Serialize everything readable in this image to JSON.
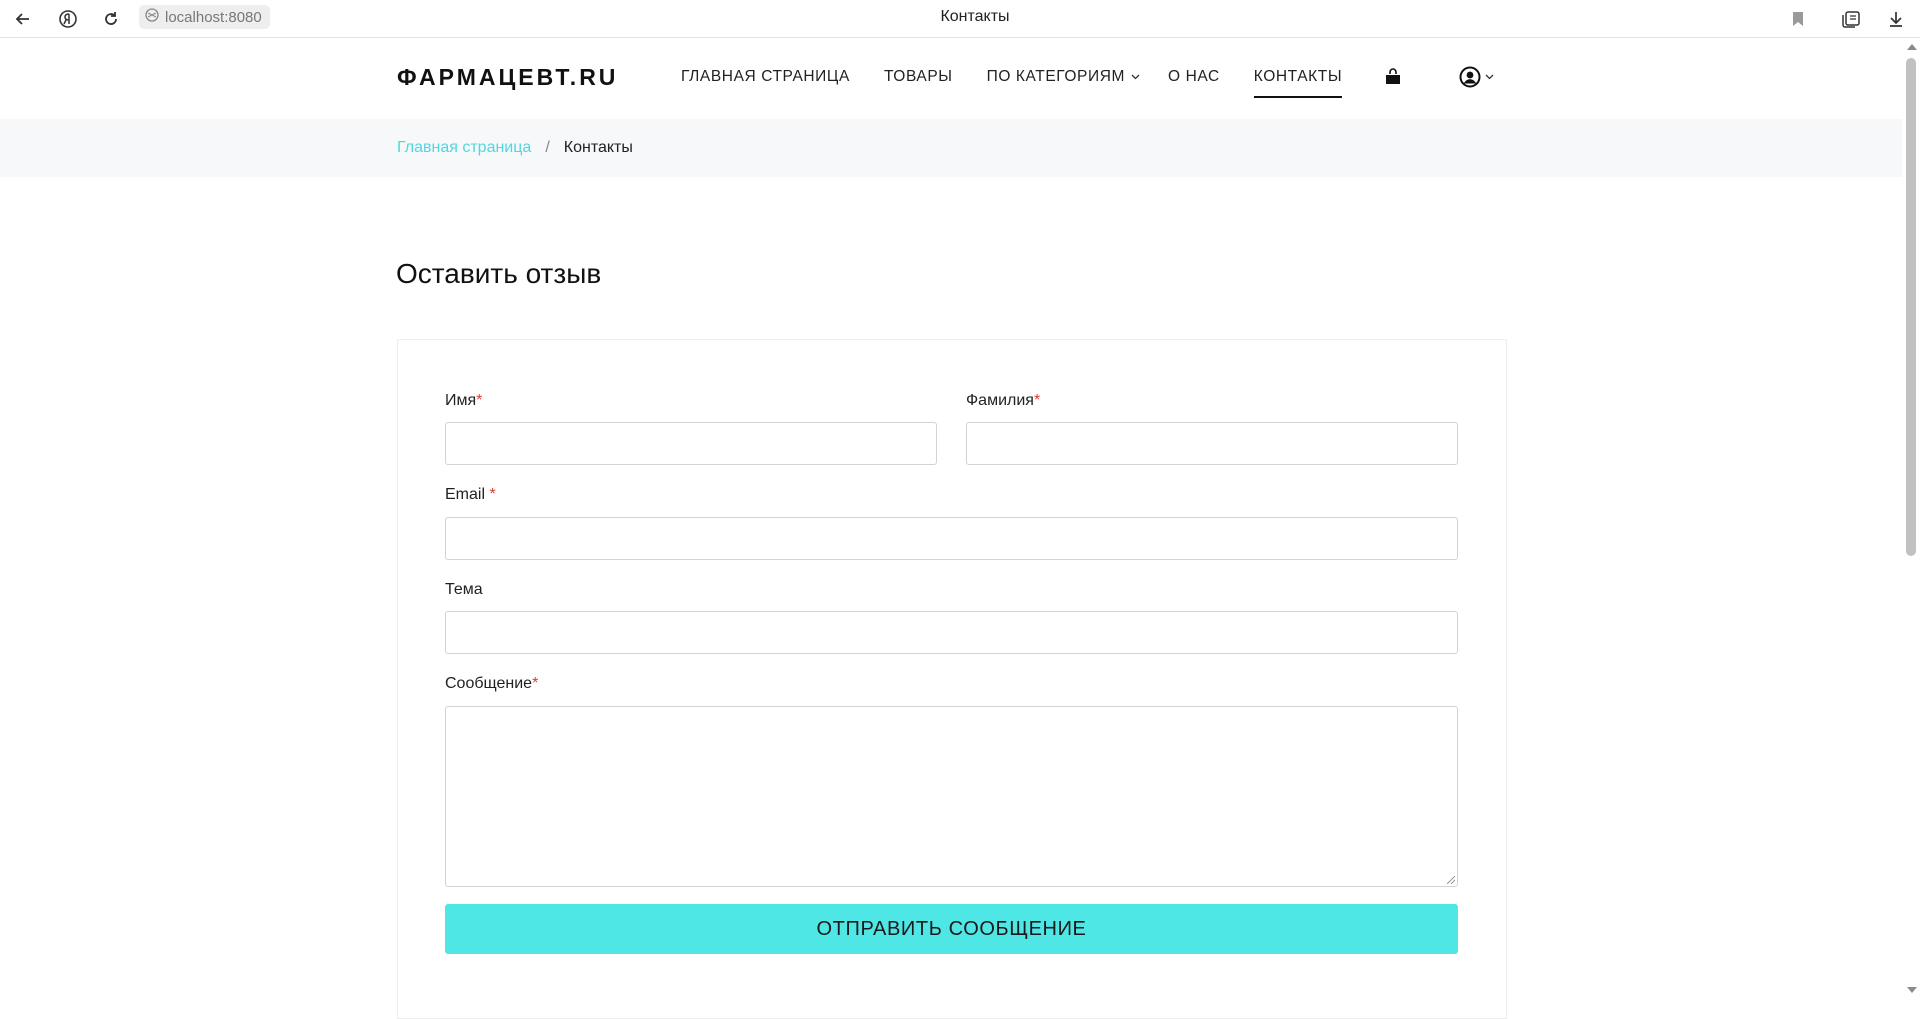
{
  "browser": {
    "address": "localhost:8080",
    "tab_title": "Контакты",
    "icons": {
      "back": "back-arrow-icon",
      "yandex": "yandex-icon",
      "reload": "reload-icon",
      "site_info": "site-info-icon",
      "bookmark": "bookmark-icon",
      "collections": "collections-icon",
      "downloads": "download-icon"
    }
  },
  "header": {
    "logo": "ФАРМАЦЕВТ.RU",
    "nav": [
      {
        "label": "Главная страница"
      },
      {
        "label": "Товары"
      },
      {
        "label": "По категориям"
      },
      {
        "label": "О нас"
      },
      {
        "label": "Контакты"
      }
    ]
  },
  "breadcrumb": {
    "home": "Главная страница",
    "separator": "/",
    "current": "Контакты"
  },
  "form": {
    "title": "Оставить отзыв",
    "first_name": {
      "label": "Имя",
      "required_mark": "*",
      "value": ""
    },
    "last_name": {
      "label": "Фамилия",
      "required_mark": "*",
      "value": ""
    },
    "email": {
      "label": "Email",
      "required_mark": "*",
      "value": ""
    },
    "subject": {
      "label": "Тема",
      "value": ""
    },
    "message": {
      "label": "Сообщение",
      "required_mark": "*",
      "value": ""
    },
    "submit_label": "Отправить сообщение"
  },
  "colors": {
    "accent": "#4fe6e6",
    "link": "#4fd8e0",
    "required": "#e03a3a"
  }
}
